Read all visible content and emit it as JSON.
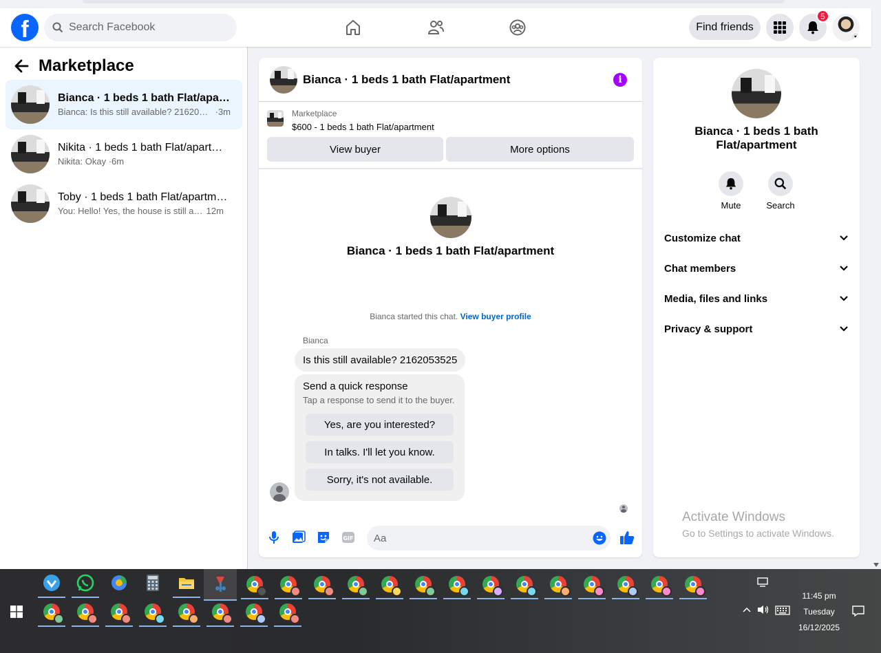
{
  "header": {
    "search_placeholder": "Search Facebook",
    "find_friends": "Find friends",
    "notif_count": "5",
    "logo_letter": "f"
  },
  "sidebar": {
    "title": "Marketplace",
    "conversations": [
      {
        "title": "Bianca · 1 beds 1 bath Flat/apartment",
        "preview": "Bianca: Is this still available? 2162053525",
        "time": "3m"
      },
      {
        "title": "Nikita · 1 beds 1 bath Flat/apartment",
        "preview": "Nikita: Okay",
        "time": "6m"
      },
      {
        "title": "Toby · 1 beds 1 bath Flat/apartment",
        "preview": "You: Hello! Yes, the house is still available",
        "time": "12m"
      }
    ]
  },
  "chat": {
    "title": "Bianca · 1 beds 1 bath Flat/apartment",
    "marketplace_label": "Marketplace",
    "listing": "$600 - 1 beds 1 bath Flat/apartment",
    "view_buyer": "View buyer",
    "more_options": "More options",
    "intro_title": "Bianca · 1 beds 1 bath Flat/apartment",
    "started_text": "Bianca started this chat.",
    "view_profile": "View buyer profile",
    "sender": "Bianca",
    "message": "Is this still available? 2162053525",
    "quick_title": "Send a quick response",
    "quick_sub": "Tap a response to send it to the buyer.",
    "quick_replies": [
      "Yes, are you interested?",
      "In talks. I'll let you know.",
      "Sorry, it's not available."
    ],
    "composer_placeholder": "Aa"
  },
  "details": {
    "title": "Bianca · 1 beds 1 bath Flat/apartment",
    "mute": "Mute",
    "search": "Search",
    "sections": [
      "Customize chat",
      "Chat members",
      "Media, files and links",
      "Privacy & support"
    ]
  },
  "watermark": {
    "line1": "Activate Windows",
    "line2": "Go to Settings to activate Windows."
  },
  "taskbar": {
    "time": "11:45 pm",
    "day": "Tuesday",
    "date": "16/12/2025"
  },
  "colors": {
    "accent": "#0866ff",
    "info": "#a200ff",
    "badge": "#e41e3f"
  }
}
